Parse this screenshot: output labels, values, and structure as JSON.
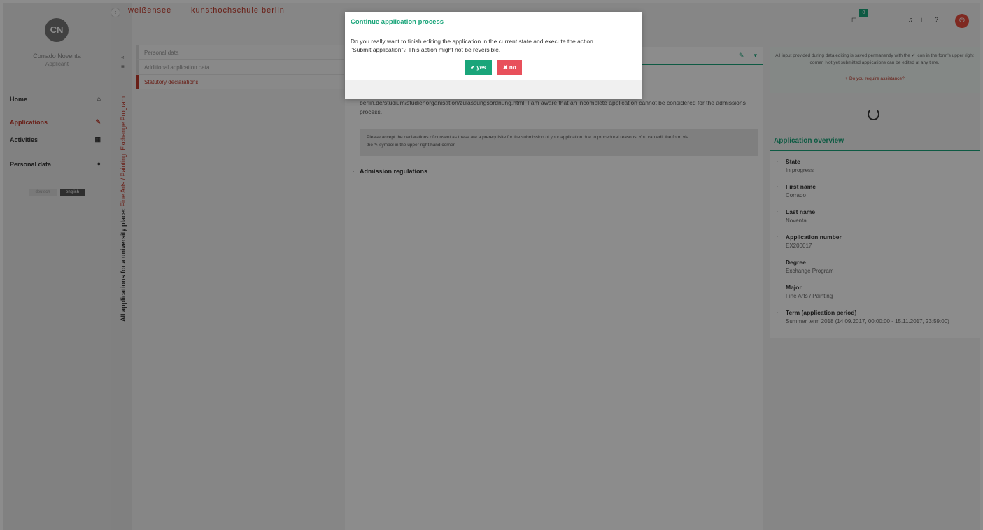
{
  "brand": {
    "part1": "weißensee",
    "part2": "kunsthochschule berlin"
  },
  "user": {
    "initials": "CN",
    "name": "Corrado Noventa",
    "role": "Applicant"
  },
  "nav": [
    {
      "label": "Home",
      "icon": "home-icon",
      "glyph": "⌂"
    },
    {
      "label": "Applications",
      "icon": "pencil-icon",
      "glyph": "✎"
    },
    {
      "label": "Activities",
      "icon": "calendar-icon",
      "glyph": "▦"
    },
    {
      "label": "Personal data",
      "icon": "user-icon",
      "glyph": "●"
    }
  ],
  "languages": {
    "german": "deutsch",
    "english": "english"
  },
  "vertical_title": {
    "prefix": "All applications for a university place:",
    "program": "Fine Arts / Painting: Exchange Program"
  },
  "steps": [
    "Personal data",
    "Additional application data",
    "Statutory declarations"
  ],
  "main": {
    "text": "berlin.de/studium/studienorganisation/zulassungsordnung.html. I am aware that an incomplete application cannot be considered for the admissions process.",
    "note_line1": "Please accept the declarations of consent as these are a prerequisite for the submission of your application due to procedural reasons. You can edit the form via",
    "note_line2": "the ✎ symbol in the upper right hand corner.",
    "regulations": "Admission regulations",
    "tools": "✎ ⋮ ▾"
  },
  "right": {
    "info": "All input provided during data editing is saved permanently with the ✔ icon in the form's upper right corner. Not yet submitted applications can be edited at any time.",
    "assist": "♀ Do you require assistance?",
    "overview_title": "Application overview",
    "overview": [
      {
        "label": "State",
        "value": "In progress"
      },
      {
        "label": "First name",
        "value": "Corrado"
      },
      {
        "label": "Last name",
        "value": "Noventa"
      },
      {
        "label": "Application number",
        "value": "EX200017"
      },
      {
        "label": "Degree",
        "value": "Exchange Program"
      },
      {
        "label": "Major",
        "value": "Fine Arts / Painting"
      },
      {
        "label": "Term (application period)",
        "value": "Summer term 2018 (14.09.2017, 00:00:00 - 15.11.2017, 23:59:00)"
      }
    ]
  },
  "topbar": {
    "badge": "0",
    "bell": "♫",
    "info": "i",
    "help": "?",
    "power": "⏻",
    "message": "◻"
  },
  "modal": {
    "title": "Continue application process",
    "line1": "Do you really want to finish editing the application in the current state and execute the action",
    "line2": "\"Submit application\"? This action might not be reversible.",
    "yes": "✔ yes",
    "no": "✖ no"
  },
  "colors": {
    "accent_green": "#1aa57a",
    "accent_red": "#c0392b",
    "no_button": "#e8505b"
  }
}
